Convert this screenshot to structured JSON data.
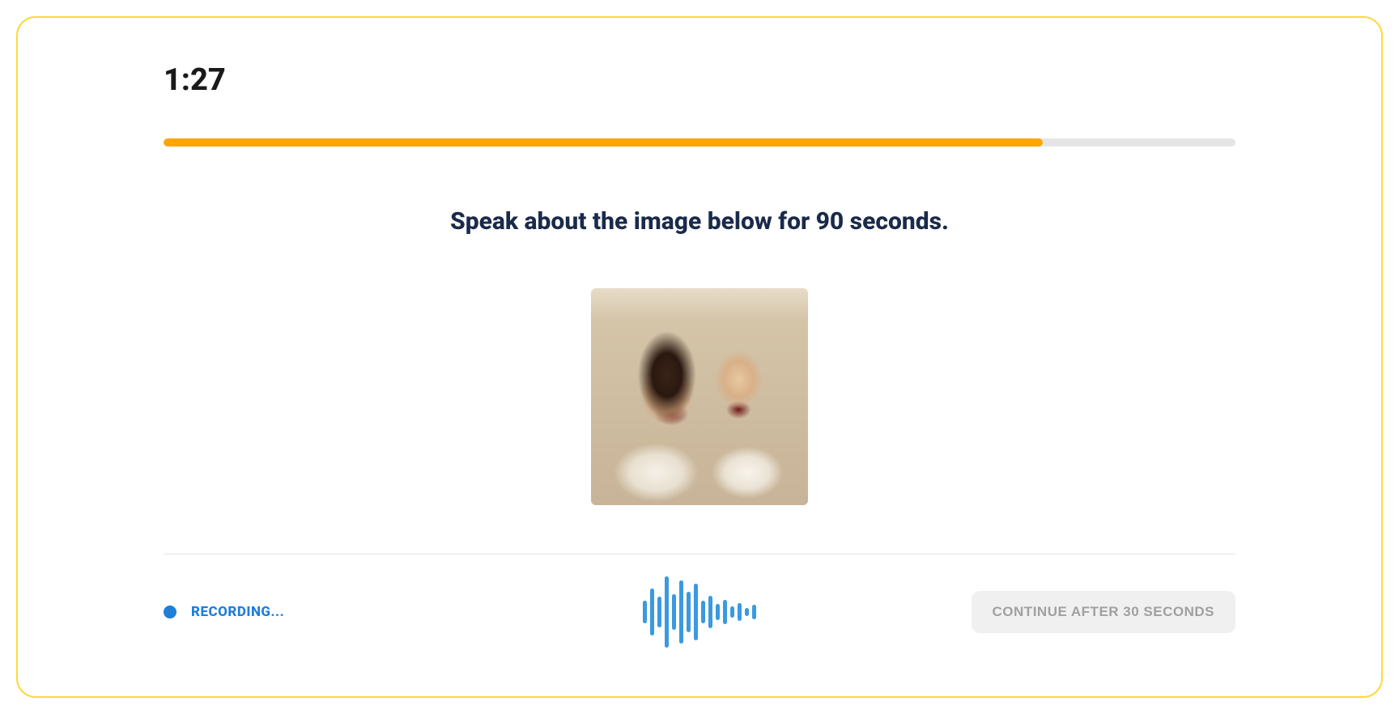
{
  "timer": {
    "display": "1:27"
  },
  "progress": {
    "percent": 82
  },
  "instruction": "Speak about the image below for 90 seconds.",
  "image": {
    "alt": "Two young children laughing together"
  },
  "status": {
    "recording_label": "RECORDING..."
  },
  "footer": {
    "continue_label": "CONTINUE AFTER 30 SECONDS"
  },
  "waveform": {
    "bars": [
      28,
      58,
      38,
      88,
      44,
      78,
      50,
      70,
      28,
      40,
      20,
      30,
      14,
      22,
      10,
      18
    ]
  },
  "colors": {
    "accent_blue": "#1f7ed8",
    "progress_orange": "#ffa500",
    "border_yellow": "#ffd83d",
    "text_dark": "#1a2a4a"
  }
}
